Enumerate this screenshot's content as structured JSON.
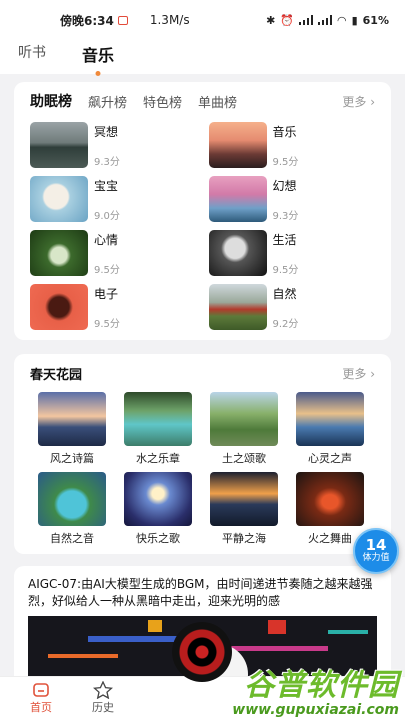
{
  "status": {
    "time": "傍晚6:34",
    "speed": "1.3M/s",
    "battery": "61"
  },
  "top_tabs": [
    {
      "label": "听书",
      "active": false
    },
    {
      "label": "音乐",
      "active": true
    }
  ],
  "ranking": {
    "tabs": [
      "助眠榜",
      "飙升榜",
      "特色榜",
      "单曲榜"
    ],
    "more": "更多",
    "items": [
      {
        "name": "冥想",
        "score": "9.3分"
      },
      {
        "name": "音乐",
        "score": "9.5分"
      },
      {
        "name": "宝宝",
        "score": "9.0分"
      },
      {
        "name": "幻想",
        "score": "9.3分"
      },
      {
        "name": "心情",
        "score": "9.5分"
      },
      {
        "name": "生活",
        "score": "9.5分"
      },
      {
        "name": "电子",
        "score": "9.5分"
      },
      {
        "name": "自然",
        "score": "9.2分"
      }
    ]
  },
  "garden": {
    "title": "春天花园",
    "more": "更多",
    "items": [
      "风之诗篇",
      "水之乐章",
      "土之颂歌",
      "心灵之声",
      "自然之音",
      "快乐之歌",
      "平静之海",
      "火之舞曲"
    ]
  },
  "stamina": {
    "value": "14",
    "label": "体力值"
  },
  "promo": {
    "text": "AIGC-07:由AI大模型生成的BGM，由时间递进节奏随之越来越强烈，好似给人一种从黑暗中走出，迎来光明的感"
  },
  "nav": [
    {
      "label": "首页",
      "icon": "home-icon",
      "active": true
    },
    {
      "label": "历史",
      "icon": "star-icon",
      "active": false
    }
  ],
  "watermark": {
    "top": "谷普软件园",
    "bottom": "www.gupuxiazai.com"
  },
  "colors": {
    "accent": "#e0523a",
    "dot": "#f08a3c",
    "stamina": "#1d8ce8"
  }
}
